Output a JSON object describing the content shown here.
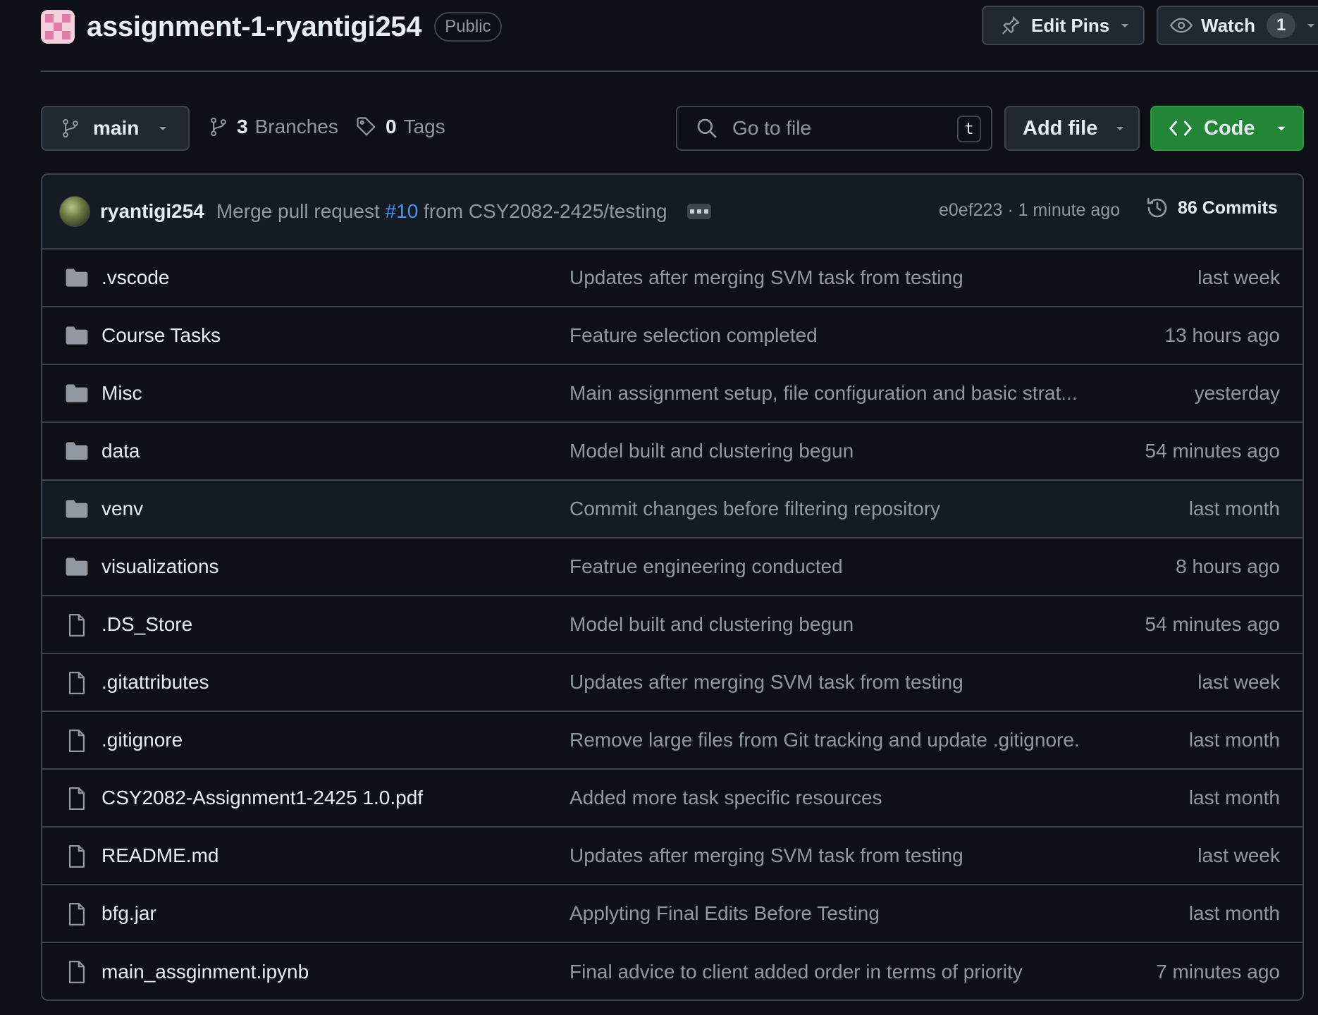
{
  "repo": {
    "name": "assignment-1-ryantigi254",
    "visibility": "Public"
  },
  "actions": {
    "edit_pins": "Edit Pins",
    "watch": "Watch",
    "watch_count": "1"
  },
  "toolbar": {
    "branch": "main",
    "branches_count": "3",
    "branches_label": "Branches",
    "tags_count": "0",
    "tags_label": "Tags",
    "search_placeholder": "Go to file",
    "search_shortcut": "t",
    "add_file": "Add file",
    "code": "Code"
  },
  "latest_commit": {
    "author": "ryantigi254",
    "message_prefix": "Merge pull request",
    "pr_link": "#10",
    "message_suffix": "from CSY2082-2425/testing",
    "hash_time": "e0ef223 · 1 minute ago",
    "commits_label": "86 Commits"
  },
  "files": [
    {
      "type": "dir",
      "name": ".vscode",
      "message": "Updates after merging SVM task from testing",
      "time": "last week"
    },
    {
      "type": "dir",
      "name": "Course Tasks",
      "message": "Feature selection completed",
      "time": "13 hours ago"
    },
    {
      "type": "dir",
      "name": "Misc",
      "message": "Main assignment setup, file configuration and basic strat...",
      "time": "yesterday"
    },
    {
      "type": "dir",
      "name": "data",
      "message": "Model built and clustering begun",
      "time": "54 minutes ago"
    },
    {
      "type": "dir",
      "name": "venv",
      "message": "Commit changes before filtering repository",
      "time": "last month"
    },
    {
      "type": "dir",
      "name": "visualizations",
      "message": "Featrue engineering conducted",
      "time": "8 hours ago"
    },
    {
      "type": "file",
      "name": ".DS_Store",
      "message": "Model built and clustering begun",
      "time": "54 minutes ago"
    },
    {
      "type": "file",
      "name": ".gitattributes",
      "message": "Updates after merging SVM task from testing",
      "time": "last week"
    },
    {
      "type": "file",
      "name": ".gitignore",
      "message": "Remove large files from Git tracking and update .gitignore.",
      "time": "last month"
    },
    {
      "type": "file",
      "name": "CSY2082-Assignment1-2425 1.0.pdf",
      "message": "Added more task specific resources",
      "time": "last month"
    },
    {
      "type": "file",
      "name": "README.md",
      "message": "Updates after merging SVM task from testing",
      "time": "last week"
    },
    {
      "type": "file",
      "name": "bfg.jar",
      "message": "Applyting Final Edits Before Testing",
      "time": "last month"
    },
    {
      "type": "file",
      "name": "main_assginment.ipynb",
      "message": "Final advice to client added order in terms of priority",
      "time": "7 minutes ago"
    }
  ],
  "colors": {
    "background": "#0d1117",
    "border": "#3d444d",
    "muted_text": "#9198a1",
    "link": "#4493f8",
    "code_button": "#238636"
  }
}
